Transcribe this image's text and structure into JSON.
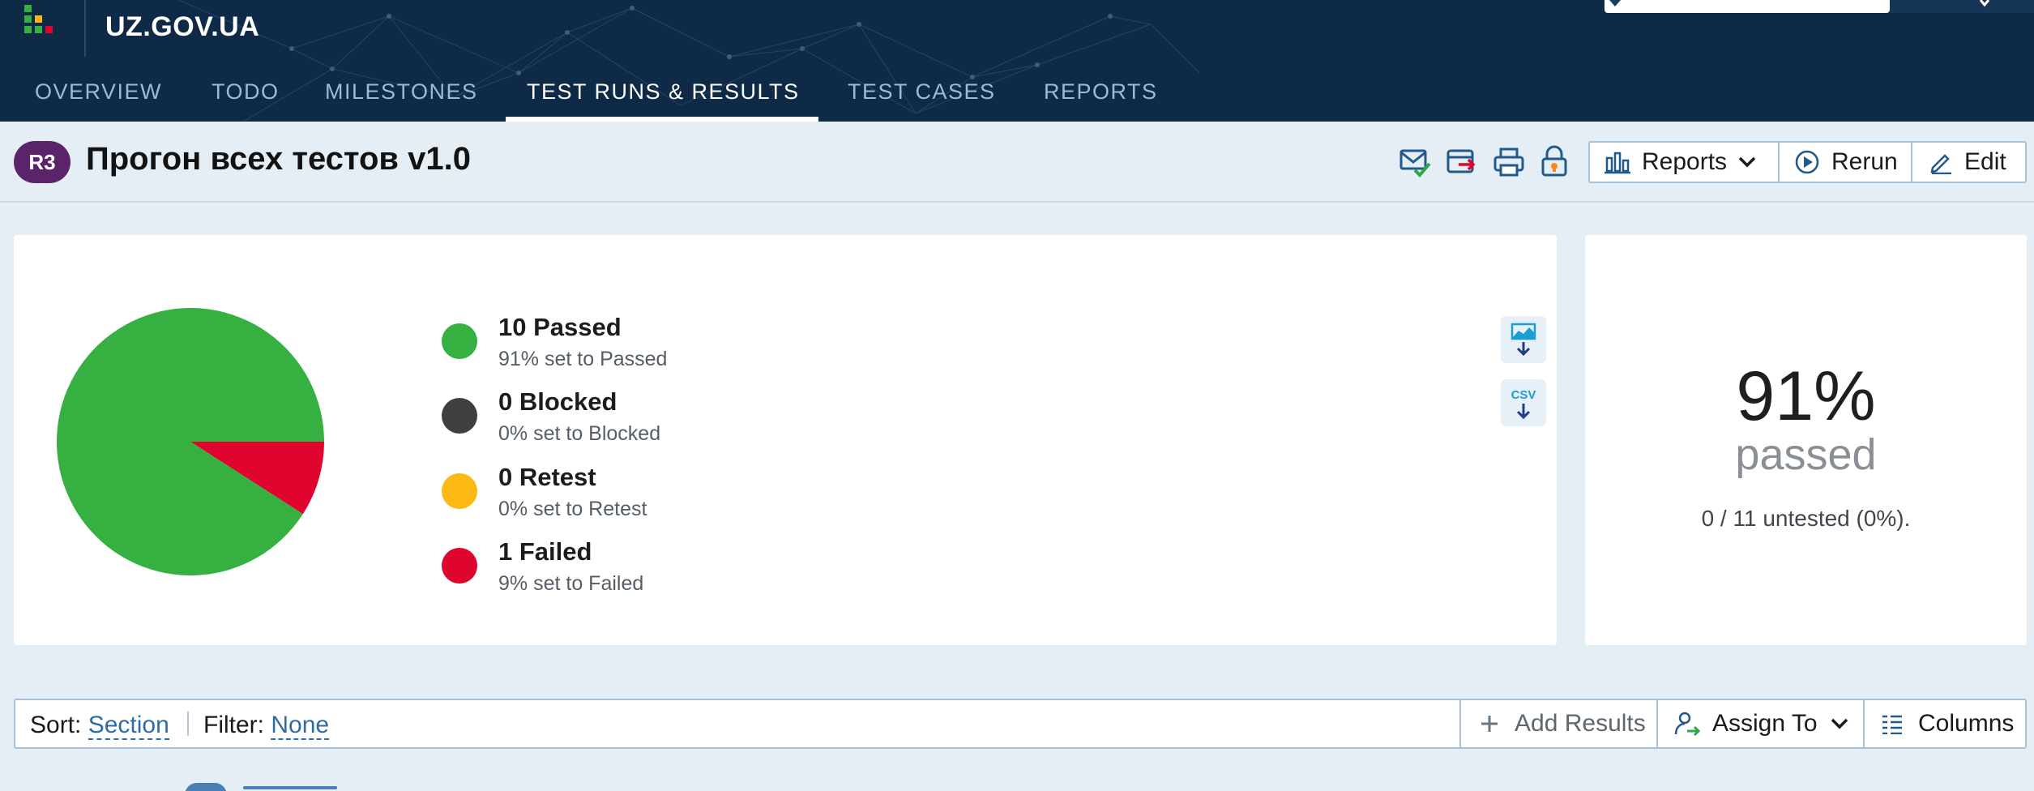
{
  "app": {
    "brand": "UZ.GOV.UA",
    "colors": {
      "header_bg": "#0f2a47",
      "nav_text": "#9cb9d6",
      "accent_link": "#2e6da4",
      "badge": "#5b2369"
    }
  },
  "nav": {
    "tabs": [
      {
        "label": "OVERVIEW",
        "active": false
      },
      {
        "label": "TODO",
        "active": false
      },
      {
        "label": "MILESTONES",
        "active": false
      },
      {
        "label": "TEST RUNS & RESULTS",
        "active": true
      },
      {
        "label": "TEST CASES",
        "active": false
      },
      {
        "label": "REPORTS",
        "active": false
      }
    ]
  },
  "run": {
    "badge": "R3",
    "title": "Прогон всех тестов v1.0",
    "toolbar_icons": [
      "mail-check-icon",
      "export-icon",
      "print-icon",
      "lock-icon"
    ],
    "buttons": {
      "reports": "Reports",
      "rerun": "Rerun",
      "edit": "Edit"
    }
  },
  "summary": {
    "legend": [
      {
        "title": "10 Passed",
        "subtitle": "91% set to Passed",
        "color": "#36b141"
      },
      {
        "title": "0 Blocked",
        "subtitle": "0% set to Blocked",
        "color": "#3f3f3f"
      },
      {
        "title": "0 Retest",
        "subtitle": "0% set to Retest",
        "color": "#fcb813"
      },
      {
        "title": "1 Failed",
        "subtitle": "9% set to Failed",
        "color": "#e0052e"
      }
    ],
    "download_icons": [
      "download-chart-icon",
      "download-csv-icon"
    ],
    "csv_label": "CSV",
    "percent": "91%",
    "percent_label": "passed",
    "untested": "0 / 11 untested (0%)."
  },
  "chart_data": {
    "type": "pie",
    "categories": [
      "Passed",
      "Blocked",
      "Retest",
      "Failed"
    ],
    "values": [
      10,
      0,
      0,
      1
    ],
    "colors": [
      "#36b141",
      "#3f3f3f",
      "#fcb813",
      "#e0052e"
    ]
  },
  "toolbar": {
    "sort_label": "Sort:",
    "sort_value": "Section",
    "filter_label": "Filter:",
    "filter_value": "None",
    "add_results": "Add Results",
    "assign_to": "Assign To",
    "columns": "Columns"
  }
}
